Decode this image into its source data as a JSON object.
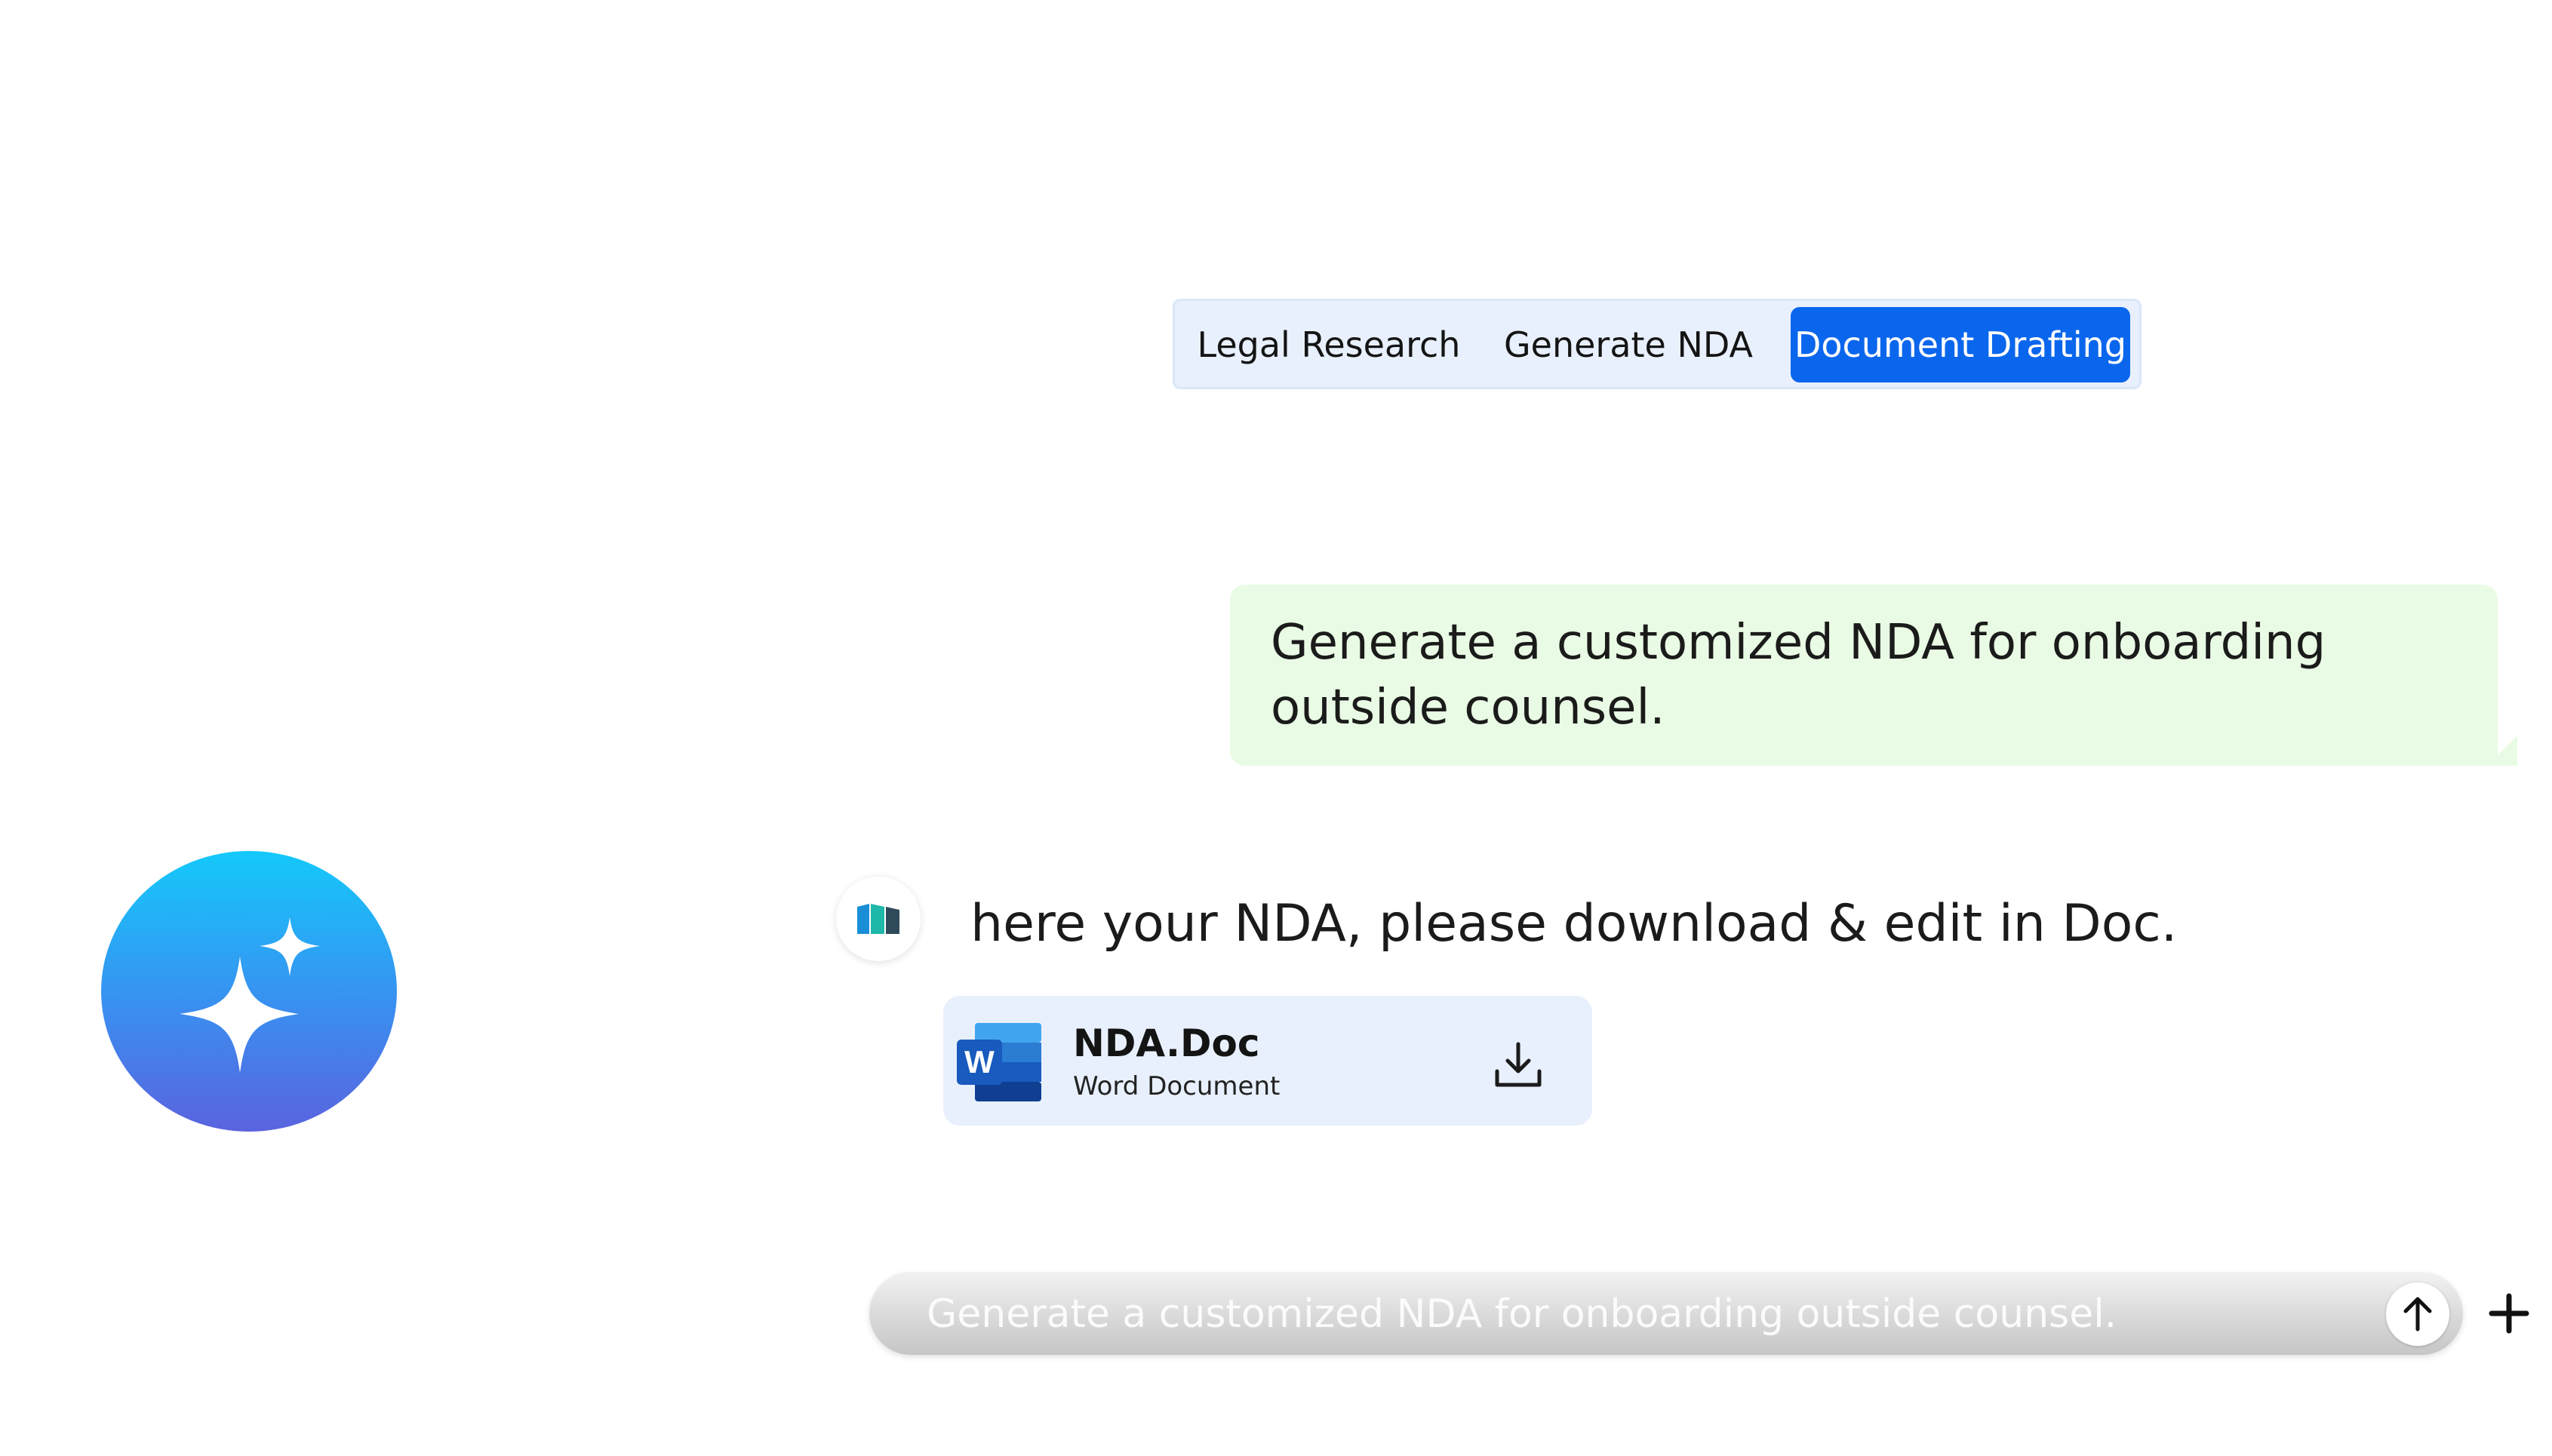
{
  "tabs": [
    {
      "label": "Legal Research",
      "active": false
    },
    {
      "label": "Generate NDA",
      "active": false
    },
    {
      "label": "Document Drafting",
      "active": true
    }
  ],
  "conversation": {
    "user_message": "Generate a customized NDA for onboarding outside counsel.",
    "assistant_message": "here your NDA, please download & edit in Doc.",
    "attachment": {
      "file_name": "NDA.Doc",
      "file_type": "Word Document",
      "icon": "word-icon",
      "action_icon": "download-icon"
    }
  },
  "composer": {
    "placeholder": "Generate a customized NDA for onboarding outside counsel.",
    "send_icon": "arrow-up-icon",
    "add_icon": "plus-icon"
  },
  "colors": {
    "accent": "#0a66ec",
    "tab_bar_bg": "#e8f0fd",
    "user_bubble_bg": "#e9fbe4",
    "badge_gradient_top": "#14c9fb",
    "badge_gradient_bottom": "#5a63df"
  }
}
